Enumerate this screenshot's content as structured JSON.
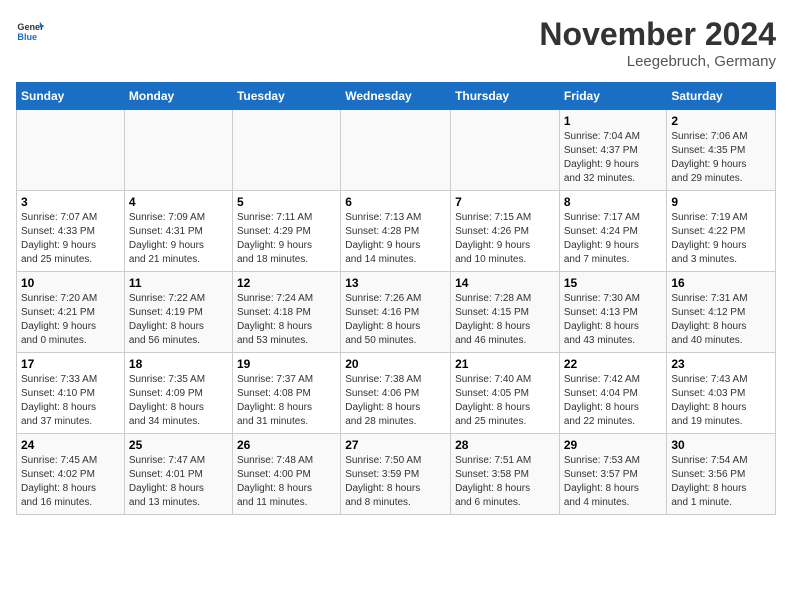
{
  "header": {
    "logo_line1": "General",
    "logo_line2": "Blue",
    "title": "November 2024",
    "subtitle": "Leegebruch, Germany"
  },
  "columns": [
    "Sunday",
    "Monday",
    "Tuesday",
    "Wednesday",
    "Thursday",
    "Friday",
    "Saturday"
  ],
  "weeks": [
    [
      {
        "day": "",
        "info": ""
      },
      {
        "day": "",
        "info": ""
      },
      {
        "day": "",
        "info": ""
      },
      {
        "day": "",
        "info": ""
      },
      {
        "day": "",
        "info": ""
      },
      {
        "day": "1",
        "info": "Sunrise: 7:04 AM\nSunset: 4:37 PM\nDaylight: 9 hours\nand 32 minutes."
      },
      {
        "day": "2",
        "info": "Sunrise: 7:06 AM\nSunset: 4:35 PM\nDaylight: 9 hours\nand 29 minutes."
      }
    ],
    [
      {
        "day": "3",
        "info": "Sunrise: 7:07 AM\nSunset: 4:33 PM\nDaylight: 9 hours\nand 25 minutes."
      },
      {
        "day": "4",
        "info": "Sunrise: 7:09 AM\nSunset: 4:31 PM\nDaylight: 9 hours\nand 21 minutes."
      },
      {
        "day": "5",
        "info": "Sunrise: 7:11 AM\nSunset: 4:29 PM\nDaylight: 9 hours\nand 18 minutes."
      },
      {
        "day": "6",
        "info": "Sunrise: 7:13 AM\nSunset: 4:28 PM\nDaylight: 9 hours\nand 14 minutes."
      },
      {
        "day": "7",
        "info": "Sunrise: 7:15 AM\nSunset: 4:26 PM\nDaylight: 9 hours\nand 10 minutes."
      },
      {
        "day": "8",
        "info": "Sunrise: 7:17 AM\nSunset: 4:24 PM\nDaylight: 9 hours\nand 7 minutes."
      },
      {
        "day": "9",
        "info": "Sunrise: 7:19 AM\nSunset: 4:22 PM\nDaylight: 9 hours\nand 3 minutes."
      }
    ],
    [
      {
        "day": "10",
        "info": "Sunrise: 7:20 AM\nSunset: 4:21 PM\nDaylight: 9 hours\nand 0 minutes."
      },
      {
        "day": "11",
        "info": "Sunrise: 7:22 AM\nSunset: 4:19 PM\nDaylight: 8 hours\nand 56 minutes."
      },
      {
        "day": "12",
        "info": "Sunrise: 7:24 AM\nSunset: 4:18 PM\nDaylight: 8 hours\nand 53 minutes."
      },
      {
        "day": "13",
        "info": "Sunrise: 7:26 AM\nSunset: 4:16 PM\nDaylight: 8 hours\nand 50 minutes."
      },
      {
        "day": "14",
        "info": "Sunrise: 7:28 AM\nSunset: 4:15 PM\nDaylight: 8 hours\nand 46 minutes."
      },
      {
        "day": "15",
        "info": "Sunrise: 7:30 AM\nSunset: 4:13 PM\nDaylight: 8 hours\nand 43 minutes."
      },
      {
        "day": "16",
        "info": "Sunrise: 7:31 AM\nSunset: 4:12 PM\nDaylight: 8 hours\nand 40 minutes."
      }
    ],
    [
      {
        "day": "17",
        "info": "Sunrise: 7:33 AM\nSunset: 4:10 PM\nDaylight: 8 hours\nand 37 minutes."
      },
      {
        "day": "18",
        "info": "Sunrise: 7:35 AM\nSunset: 4:09 PM\nDaylight: 8 hours\nand 34 minutes."
      },
      {
        "day": "19",
        "info": "Sunrise: 7:37 AM\nSunset: 4:08 PM\nDaylight: 8 hours\nand 31 minutes."
      },
      {
        "day": "20",
        "info": "Sunrise: 7:38 AM\nSunset: 4:06 PM\nDaylight: 8 hours\nand 28 minutes."
      },
      {
        "day": "21",
        "info": "Sunrise: 7:40 AM\nSunset: 4:05 PM\nDaylight: 8 hours\nand 25 minutes."
      },
      {
        "day": "22",
        "info": "Sunrise: 7:42 AM\nSunset: 4:04 PM\nDaylight: 8 hours\nand 22 minutes."
      },
      {
        "day": "23",
        "info": "Sunrise: 7:43 AM\nSunset: 4:03 PM\nDaylight: 8 hours\nand 19 minutes."
      }
    ],
    [
      {
        "day": "24",
        "info": "Sunrise: 7:45 AM\nSunset: 4:02 PM\nDaylight: 8 hours\nand 16 minutes."
      },
      {
        "day": "25",
        "info": "Sunrise: 7:47 AM\nSunset: 4:01 PM\nDaylight: 8 hours\nand 13 minutes."
      },
      {
        "day": "26",
        "info": "Sunrise: 7:48 AM\nSunset: 4:00 PM\nDaylight: 8 hours\nand 11 minutes."
      },
      {
        "day": "27",
        "info": "Sunrise: 7:50 AM\nSunset: 3:59 PM\nDaylight: 8 hours\nand 8 minutes."
      },
      {
        "day": "28",
        "info": "Sunrise: 7:51 AM\nSunset: 3:58 PM\nDaylight: 8 hours\nand 6 minutes."
      },
      {
        "day": "29",
        "info": "Sunrise: 7:53 AM\nSunset: 3:57 PM\nDaylight: 8 hours\nand 4 minutes."
      },
      {
        "day": "30",
        "info": "Sunrise: 7:54 AM\nSunset: 3:56 PM\nDaylight: 8 hours\nand 1 minute."
      }
    ]
  ]
}
